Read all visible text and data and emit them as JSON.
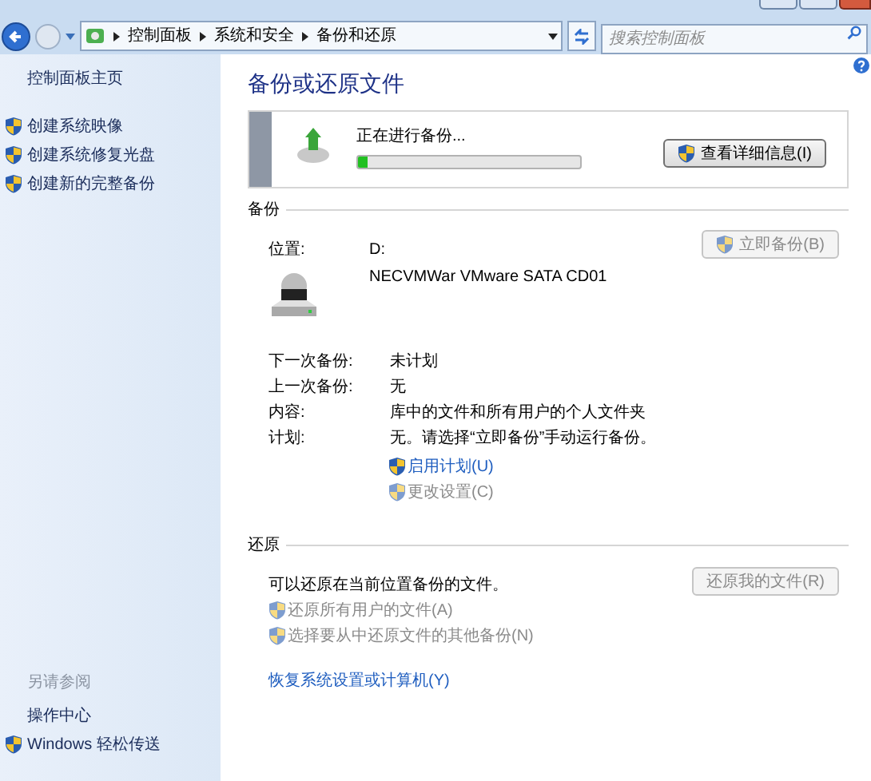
{
  "address_bar": {
    "breadcrumbs": [
      "控制面板",
      "系统和安全",
      "备份和还原"
    ],
    "search_placeholder": "搜索控制面板"
  },
  "sidebar": {
    "home": "控制面板主页",
    "tasks": [
      {
        "label": "创建系统映像"
      },
      {
        "label": "创建系统修复光盘"
      },
      {
        "label": "创建新的完整备份"
      }
    ],
    "see_also": {
      "heading": "另请参阅",
      "links": [
        {
          "label": "操作中心",
          "shield": false
        },
        {
          "label": "Windows 轻松传送",
          "shield": true
        }
      ]
    }
  },
  "main": {
    "title": "备份或还原文件",
    "progress": {
      "status": "正在进行备份...",
      "level": 0.04,
      "button": "查看详细信息(I)"
    },
    "backup": {
      "heading": "备份",
      "location_label": "位置:",
      "location_values": [
        "D:",
        "NECVMWar VMware SATA CD01"
      ],
      "backup_now_button": {
        "label": "立即备份(B)",
        "disabled": true
      },
      "details": [
        {
          "label": "下一次备份:",
          "value": "未计划"
        },
        {
          "label": "上一次备份:",
          "value": "无"
        },
        {
          "label": "内容:",
          "value": "库中的文件和所有用户的个人文件夹"
        },
        {
          "label": "计划:",
          "value": "无。请选择“立即备份”手动运行备份。"
        }
      ],
      "links": [
        {
          "label": "启用计划(U)",
          "disabled": false
        },
        {
          "label": "更改设置(C)",
          "disabled": true
        }
      ]
    },
    "restore": {
      "heading": "还原",
      "description": "可以还原在当前位置备份的文件。",
      "button": {
        "label": "还原我的文件(R)",
        "disabled": true
      },
      "links": [
        {
          "label": "还原所有用户的文件(A)",
          "disabled": true
        },
        {
          "label": "选择要从中还原文件的其他备份(N)",
          "disabled": true
        }
      ]
    },
    "recovery_link": "恢复系统设置或计算机(Y)"
  }
}
